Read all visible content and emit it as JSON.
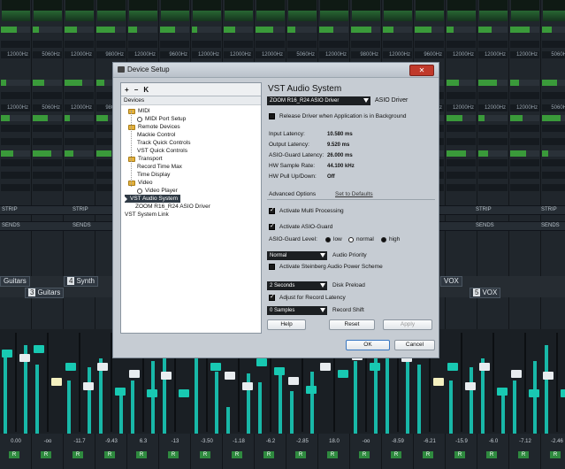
{
  "dialog": {
    "title": "Device Setup",
    "toolbar": {
      "add": "+",
      "remove": "−",
      "reset": "K"
    },
    "tree_header": "Devices",
    "tree": [
      {
        "label": "MIDI",
        "kind": "folder"
      },
      {
        "label": "MIDI Port Setup",
        "kind": "device"
      },
      {
        "label": "Remote Devices",
        "kind": "folder"
      },
      {
        "label": "Mackie Control",
        "kind": "item"
      },
      {
        "label": "Track Quick Controls",
        "kind": "item"
      },
      {
        "label": "VST Quick Controls",
        "kind": "item"
      },
      {
        "label": "Transport",
        "kind": "folder"
      },
      {
        "label": "Record Time Max",
        "kind": "item"
      },
      {
        "label": "Time Display",
        "kind": "item"
      },
      {
        "label": "Video",
        "kind": "folder"
      },
      {
        "label": "Video Player",
        "kind": "device"
      },
      {
        "label": "VST Audio System",
        "kind": "selected"
      },
      {
        "label": "ZOOM R16_R24 ASIO Driver",
        "kind": "item"
      },
      {
        "label": "VST System Link",
        "kind": "item"
      }
    ],
    "panel": {
      "title": "VST Audio System",
      "driver_value": "ZOOM R16_R24 ASIO Driver",
      "driver_label": "ASIO Driver",
      "release_driver": "Release Driver when Application is in Background",
      "input_latency_label": "Input Latency:",
      "input_latency": "10.580 ms",
      "output_latency_label": "Output Latency:",
      "output_latency": "9.520 ms",
      "guard_latency_label": "ASIO-Guard Latency:",
      "guard_latency": "26.000 ms",
      "sample_rate_label": "HW Sample Rate:",
      "sample_rate": "44.100 kHz",
      "pull_label": "HW Pull Up/Down:",
      "pull": "Off",
      "advanced": "Advanced Options",
      "set_defaults": "Set to Defaults",
      "multi_processing": "Activate Multi Processing",
      "asio_guard": "Activate ASIO-Guard",
      "guard_level_label": "ASIO-Guard Level:",
      "level_low": "low",
      "level_normal": "normal",
      "level_high": "high",
      "priority_value": "Normal",
      "priority_label": "Audio Priority",
      "power_scheme": "Activate Steinberg Audio Power Scheme",
      "preload_value": "2 Seconds",
      "preload_label": "Disk Preload",
      "adjust_latency": "Adjust for Record Latency",
      "shift_value": "0 Samples",
      "shift_label": "Record Shift"
    },
    "buttons": {
      "help": "Help",
      "reset": "Reset",
      "apply": "Apply",
      "ok": "OK",
      "cancel": "Cancel"
    }
  },
  "mixer": {
    "strip_label": "STRIP",
    "sends_label": "SENDS",
    "tracks": [
      {
        "num": "3",
        "name": "Guitars"
      },
      {
        "num": "4",
        "name": "Synth"
      },
      {
        "num": "5",
        "name": "VOX"
      }
    ],
    "left_tab": "Guitars",
    "vox_tab": "VOX",
    "fader_values": [
      "0.00",
      "-oo",
      "-11.7",
      "-9.43",
      "6.3",
      "-13",
      "-3.50",
      "-1.18",
      "-6.2",
      "-2.85",
      "18.0",
      "-oo",
      "-8.59",
      "-6.21",
      "-15.9",
      "-6.0",
      "-7.12",
      "-2.46",
      "-6.9",
      "-12.2",
      "-oo",
      "-oo",
      "-3.71",
      "0.00"
    ],
    "freq_values": [
      "12000Hz",
      "5060Hz",
      "12000Hz",
      "9800Hz",
      "12000Hz",
      "9600Hz",
      "12000Hz",
      "12000Hz"
    ],
    "misc_values": [
      "11.0dB",
      "14.0dB",
      "-4.6dB",
      "-11.6dB",
      "1.60dB",
      "-4.5",
      "2...ce"
    ],
    "colors": {
      "meter": "#18b8a8",
      "cap_teal": "#18c9b2",
      "cap_yellow": "#f4f0c0",
      "cap_white": "#e8ecef",
      "eq_green": "#2e7a3a"
    }
  }
}
